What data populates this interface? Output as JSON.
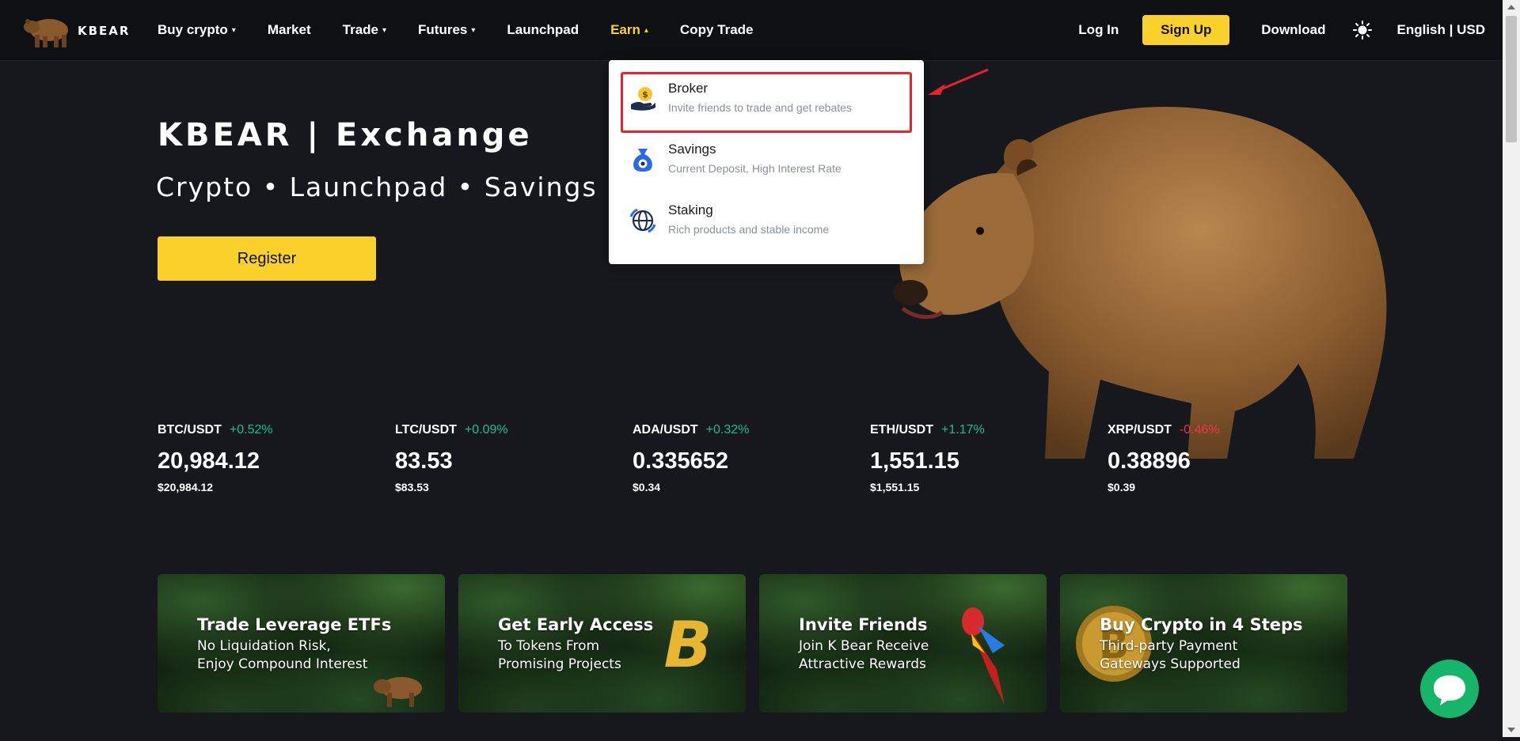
{
  "logo": {
    "text": "KBEAR"
  },
  "nav": {
    "items": [
      {
        "label": "Buy crypto",
        "caret": "▾"
      },
      {
        "label": "Market"
      },
      {
        "label": "Trade",
        "caret": "▾"
      },
      {
        "label": "Futures",
        "caret": "▾"
      },
      {
        "label": "Launchpad"
      },
      {
        "label": "Earn",
        "caret": "▴",
        "active": true
      },
      {
        "label": "Copy Trade"
      }
    ],
    "login": "Log In",
    "signup": "Sign Up",
    "download": "Download",
    "theme_icon": "sun-icon",
    "language": "English | USD"
  },
  "hero": {
    "title": "KBEAR | Exchange",
    "subtitle": "Crypto • Launchpad • Savings",
    "register": "Register"
  },
  "earn_menu": {
    "items": [
      {
        "title": "Broker",
        "desc": "Invite friends to trade and get rebates",
        "icon": "coin-hand-icon"
      },
      {
        "title": "Savings",
        "desc": "Current Deposit, High Interest Rate",
        "icon": "money-bag-icon"
      },
      {
        "title": "Staking",
        "desc": "Rich products and stable income",
        "icon": "globe-icon"
      }
    ]
  },
  "tickers": [
    {
      "pair": "BTC/USDT",
      "change": "+0.52%",
      "direction": "up",
      "price": "20,984.12",
      "usd": "$20,984.12"
    },
    {
      "pair": "LTC/USDT",
      "change": "+0.09%",
      "direction": "up",
      "price": "83.53",
      "usd": "$83.53"
    },
    {
      "pair": "ADA/USDT",
      "change": "+0.32%",
      "direction": "up",
      "price": "0.335652",
      "usd": "$0.34"
    },
    {
      "pair": "ETH/USDT",
      "change": "+1.17%",
      "direction": "up",
      "price": "1,551.15",
      "usd": "$1,551.15"
    },
    {
      "pair": "XRP/USDT",
      "change": "-0.46%",
      "direction": "down",
      "price": "0.38896",
      "usd": "$0.39"
    }
  ],
  "banners": [
    {
      "title": "Trade Leverage ETFs",
      "line1": "No Liquidation Risk,",
      "line2": "Enjoy Compound  Interest"
    },
    {
      "title": "Get Early Access",
      "line1": "To Tokens From",
      "line2": "Promising Projects"
    },
    {
      "title": "Invite Friends",
      "line1": "Join K Bear Receive",
      "line2": "Attractive Rewards"
    },
    {
      "title": "Buy Crypto in 4 Steps",
      "line1": "Third-party Payment",
      "line2": "Gateways Supported"
    }
  ],
  "colors": {
    "accent": "#f9d12a",
    "up": "#13c288",
    "down": "#f0344f",
    "background": "#16181d",
    "highlight": "#e8212a",
    "chat": "#16b56a"
  }
}
